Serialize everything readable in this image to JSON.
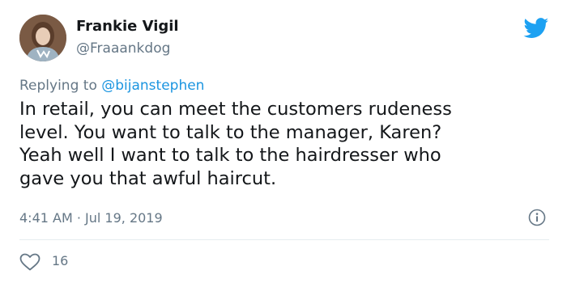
{
  "user": {
    "display_name": "Frankie Vigil",
    "handle": "@Fraaankdog"
  },
  "reply": {
    "prefix": "Replying to ",
    "mention": "@bijanstephen"
  },
  "tweet": {
    "text": "In retail, you can meet the customers rudeness\nlevel. You want to talk to the manager, Karen?\nYeah well I want to talk to the hairdresser who\ngave you that awful haircut.",
    "timestamp": "4:41 AM · Jul 19, 2019",
    "like_count": "16"
  },
  "icons": {
    "brand": "twitter-bird-icon",
    "info": "info-icon",
    "like": "heart-icon"
  },
  "colors": {
    "brand": "#1da1f2",
    "mention": "#1b95e0",
    "secondary_text": "#657786"
  }
}
